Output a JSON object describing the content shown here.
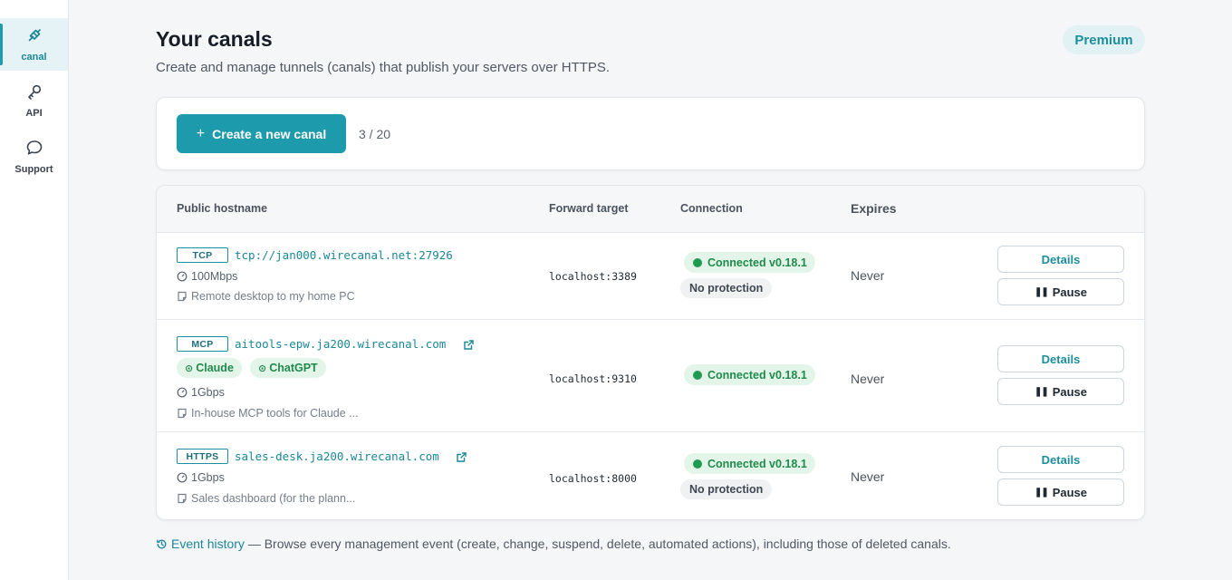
{
  "sidebar": {
    "items": [
      {
        "label": "canal",
        "icon": "plug-icon",
        "active": true
      },
      {
        "label": "API",
        "icon": "key-icon",
        "active": false
      },
      {
        "label": "Support",
        "icon": "chat-bubble-icon",
        "active": false
      }
    ]
  },
  "header": {
    "title": "Your canals",
    "subtitle": "Create and manage tunnels (canals) that publish your servers over HTTPS.",
    "plan_badge": "Premium"
  },
  "create": {
    "button_label": "Create a new canal",
    "count": "3 / 20"
  },
  "table": {
    "columns": {
      "hostname": "Public hostname",
      "target": "Forward target",
      "connection": "Connection",
      "expires": "Expires"
    },
    "rows": [
      {
        "protocol": "TCP",
        "hostname": "tcp://jan000.wirecanal.net:27926",
        "bandwidth": "100Mbps",
        "description": "Remote desktop to my home PC",
        "target": "localhost:3389",
        "connection": "Connected v0.18.1",
        "protection": "No protection",
        "expires": "Never",
        "details_label": "Details",
        "pause_label": "Pause"
      },
      {
        "protocol": "MCP",
        "hostname": "aitools-epw.ja200.wirecanal.com",
        "clients": [
          "Claude",
          "ChatGPT"
        ],
        "bandwidth": "1Gbps",
        "description": "In-house MCP tools for Claude ...",
        "target": "localhost:9310",
        "connection": "Connected v0.18.1",
        "expires": "Never",
        "details_label": "Details",
        "pause_label": "Pause"
      },
      {
        "protocol": "HTTPS",
        "hostname": "sales-desk.ja200.wirecanal.com",
        "bandwidth": "1Gbps",
        "description": "Sales dashboard (for the plann...",
        "target": "localhost:8000",
        "connection": "Connected v0.18.1",
        "protection": "No protection",
        "expires": "Never",
        "details_label": "Details",
        "pause_label": "Pause"
      }
    ]
  },
  "footer": {
    "link_label": "Event history",
    "text": " — Browse every management event (create, change, suspend, delete, automated actions), including those of deleted canals."
  },
  "colors": {
    "accent": "#1d9aab",
    "success_bg": "#e3f5e8",
    "success_text": "#1f8a4c"
  }
}
